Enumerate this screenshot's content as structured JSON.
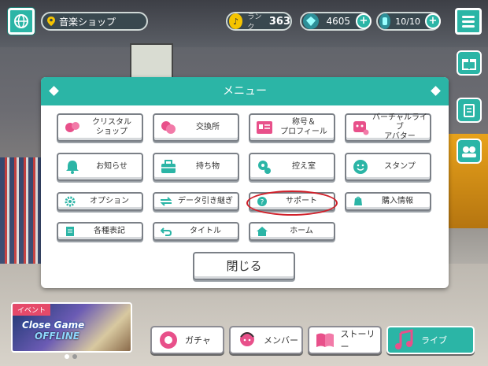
{
  "topbar": {
    "location": "音楽ショップ",
    "rank_label": "ランク",
    "rank_value": "363",
    "crystals": "4605",
    "energy": "10/10",
    "plus_symbol": "+"
  },
  "menu": {
    "title": "メニュー",
    "items": [
      {
        "label": "クリスタル\nショップ",
        "icon": "crystal-icon"
      },
      {
        "label": "交換所",
        "icon": "exchange-icon"
      },
      {
        "label": "称号＆\nプロフィール",
        "icon": "profile-card-icon"
      },
      {
        "label": "バーチャルライブ\nアバター",
        "icon": "avatar-icon"
      },
      {
        "label": "お知らせ",
        "icon": "bell-icon"
      },
      {
        "label": "持ち物",
        "icon": "bag-icon"
      },
      {
        "label": "控え室",
        "icon": "waiting-room-icon"
      },
      {
        "label": "スタンプ",
        "icon": "smile-icon"
      },
      {
        "label": "オプション",
        "icon": "gear-icon"
      },
      {
        "label": "データ引き継ぎ",
        "icon": "data-transfer-icon"
      },
      {
        "label": "サポート",
        "icon": "question-icon"
      },
      {
        "label": "購入情報",
        "icon": "purchase-info-icon"
      },
      {
        "label": "各種表記",
        "icon": "document-icon"
      },
      {
        "label": "タイトル",
        "icon": "return-icon"
      },
      {
        "label": "ホーム",
        "icon": "home-icon"
      }
    ],
    "close_label": "閉じる"
  },
  "event": {
    "tag": "イベント",
    "title": "Close Game",
    "subtitle": "OFFLINE"
  },
  "bottom_nav": [
    {
      "label": "ガチャ",
      "icon": "gacha-icon"
    },
    {
      "label": "メンバー",
      "icon": "member-icon"
    },
    {
      "label": "ストーリー",
      "icon": "book-icon"
    },
    {
      "label": "ライブ",
      "icon": "music-note-icon"
    }
  ],
  "colors": {
    "accent": "#2bb5a6",
    "highlight_ring": "#d0202a"
  }
}
